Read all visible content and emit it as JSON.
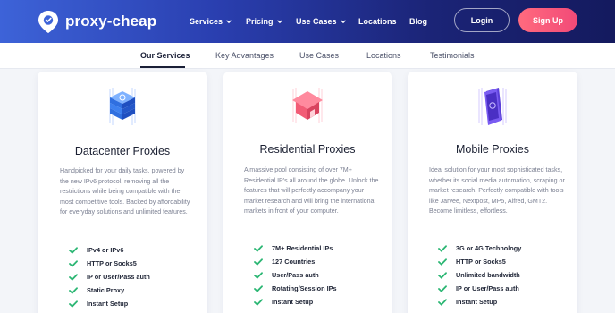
{
  "brand": {
    "name": "proxy-cheap"
  },
  "nav": {
    "services": "Services",
    "pricing": "Pricing",
    "use_cases": "Use Cases",
    "locations": "Locations",
    "blog": "Blog",
    "login": "Login",
    "signup": "Sign Up"
  },
  "subnav": {
    "tabs": [
      "Our Services",
      "Key Advantages",
      "Use Cases",
      "Locations",
      "Testimonials"
    ],
    "active": "Our Services"
  },
  "cards": [
    {
      "title": "Datacenter Proxies",
      "icon": "server-stack-icon",
      "description": "Handpicked for your daily tasks, powered by the new IPv6 protocol, removing all the restrictions while being compatible with the most competitive tools. Backed by affordability for everyday solutions and unlimited features.",
      "features": [
        "IPv4 or IPv6",
        "HTTP or Socks5",
        "IP or User/Pass auth",
        "Static Proxy",
        "Instant Setup"
      ]
    },
    {
      "title": "Residential Proxies",
      "icon": "house-icon",
      "description": "A massive pool consisting of over 7M+ Residential IP's all around the globe. Unlock the features that will perfectly accompany your market research and will bring the international markets in front of your computer.",
      "features": [
        "7M+ Residential IPs",
        "127 Countries",
        "User/Pass auth",
        "Rotating/Session IPs",
        "Instant Setup"
      ]
    },
    {
      "title": "Mobile Proxies",
      "icon": "smartphone-icon",
      "description": "Ideal solution for your most sophisticated tasks, whether its social media automation, scraping or market research. Perfectly compatible with tools like Jarvee, Nextpost, MP5, Alfred, GMT2. Become limitless, effortless.",
      "features": [
        "3G or 4G Technology",
        "HTTP or Socks5",
        "Unlimited bandwidth",
        "IP or User/Pass auth",
        "Instant Setup"
      ]
    }
  ],
  "colors": {
    "header_gradient_start": "#3d63d8",
    "header_gradient_end": "#141a5e",
    "signup_pink": "#f24a78",
    "check_green": "#2bb673",
    "page_bg": "#f3f5f9"
  }
}
